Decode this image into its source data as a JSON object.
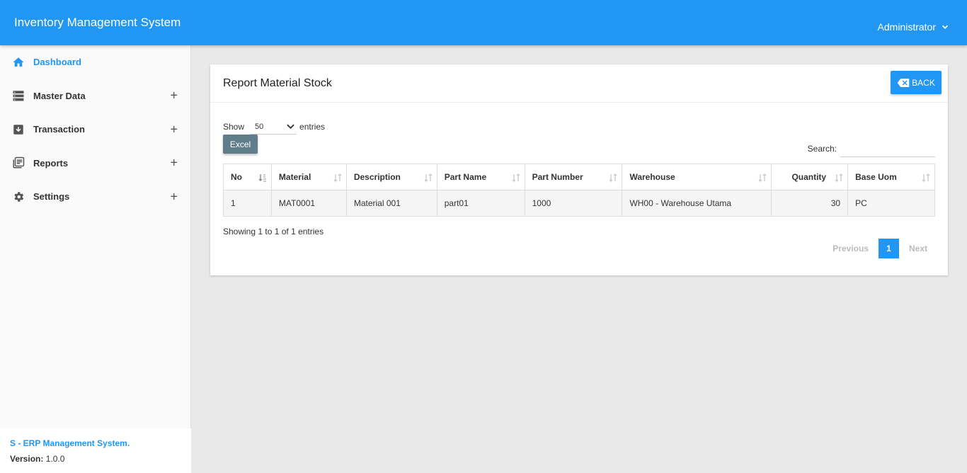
{
  "header": {
    "app_title": "Inventory Management System",
    "user": "Administrator"
  },
  "sidebar": {
    "items": [
      {
        "label": "Dashboard",
        "icon": "home-icon",
        "active": true
      },
      {
        "label": "Master Data",
        "icon": "server-icon",
        "expand": "+"
      },
      {
        "label": "Transaction",
        "icon": "archive-icon",
        "expand": "+"
      },
      {
        "label": "Reports",
        "icon": "library-books-icon",
        "expand": "+"
      },
      {
        "label": "Settings",
        "icon": "gear-icon",
        "expand": "+"
      }
    ],
    "footer": {
      "brand": "S - ERP Management System",
      "brand_dot": ".",
      "version_label": "Version:",
      "version": "1.0.0"
    }
  },
  "card": {
    "title": "Report Material Stock",
    "back_label": "BACK",
    "show_label": "Show",
    "show_value": "50",
    "entries_label": "entries",
    "excel_label": "Excel",
    "search_label": "Search:",
    "search_value": "",
    "table": {
      "headers": [
        "No",
        "Material",
        "Description",
        "Part Name",
        "Part Number",
        "Warehouse",
        "Quantity",
        "Base Uom"
      ],
      "rows": [
        [
          "1",
          "MAT0001",
          "Material 001",
          "part01",
          "1000",
          "WH00 - Warehouse Utama",
          "30",
          "PC"
        ]
      ]
    },
    "info": "Showing 1 to 1 of 1 entries",
    "pager": {
      "previous": "Previous",
      "current": "1",
      "next": "Next"
    }
  },
  "colors": {
    "primary": "#2196f3",
    "excel": "#607d8b"
  }
}
